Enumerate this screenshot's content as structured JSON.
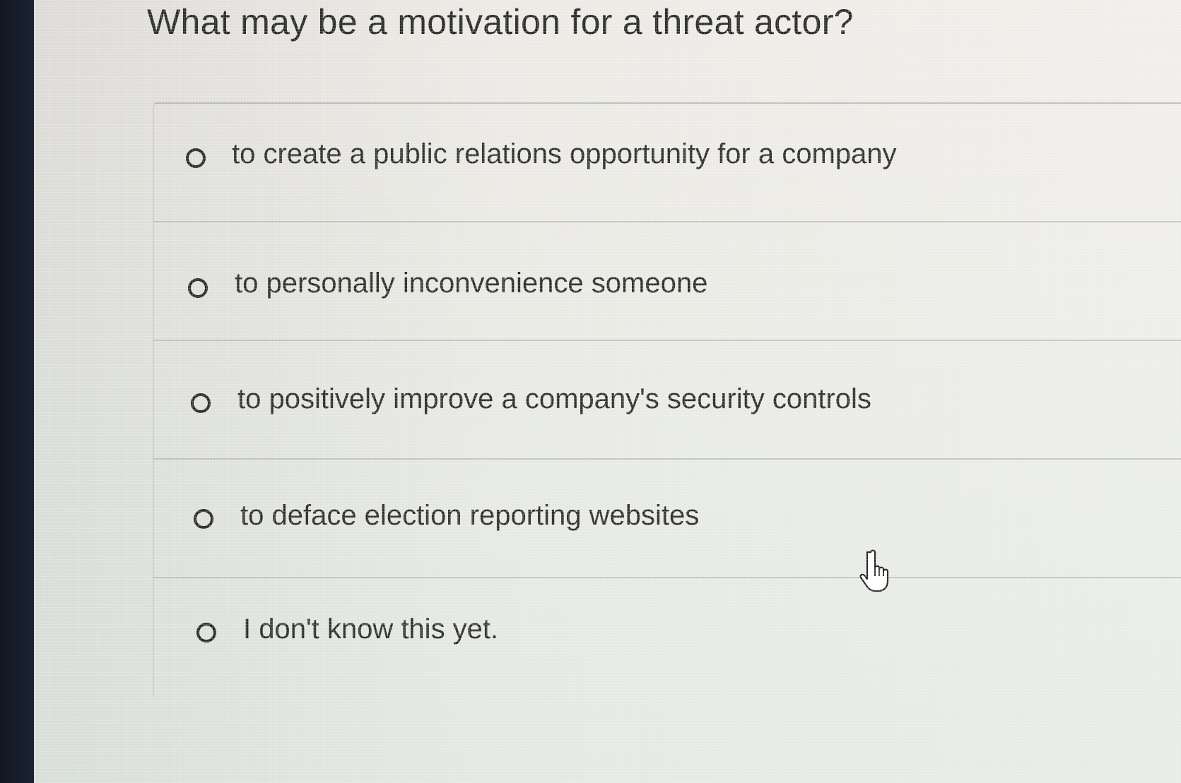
{
  "quiz": {
    "question": "What may be a motivation for a threat actor?",
    "options": [
      {
        "label": "to create a public relations opportunity for a company"
      },
      {
        "label": "to personally inconvenience someone"
      },
      {
        "label": "to positively improve a company's security controls"
      },
      {
        "label": "to deface election reporting websites"
      },
      {
        "label": "I don't know this yet."
      }
    ]
  },
  "icons": {
    "radio": "radio-unchecked-icon",
    "cursor": "hand-pointer-icon"
  },
  "colors": {
    "text": "#2e2e2e",
    "background": "#ece9e4",
    "bezel": "#1a2130"
  }
}
